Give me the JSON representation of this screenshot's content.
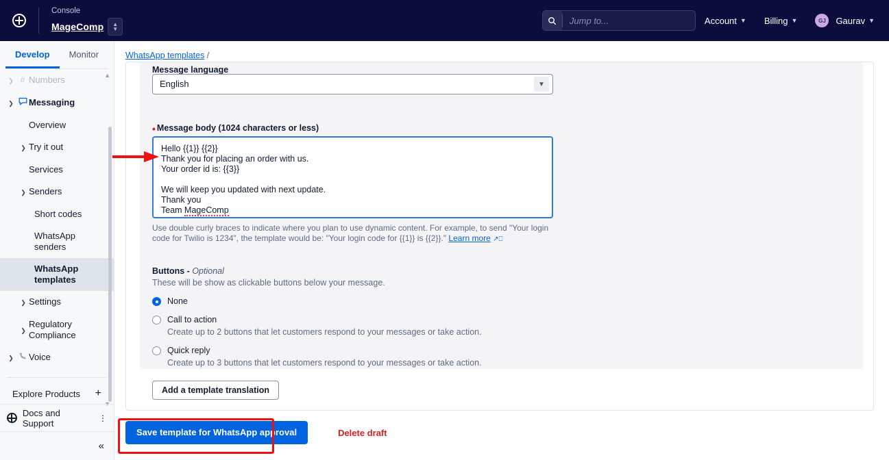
{
  "topnav": {
    "logo_icon": "twilio-logo-icon",
    "console_label": "Console",
    "account_name": "MageComp",
    "account_switcher_icon": "chevron-updown-icon",
    "search": {
      "icon": "search-icon",
      "placeholder": "Jump to...",
      "value": ""
    },
    "account_menu": "Account",
    "billing_menu": "Billing",
    "user_initials": "GJ",
    "user_name": "Gaurav",
    "caret_icon": "chevron-down-icon",
    "bg_color": "#0d0d3d"
  },
  "sidebar": {
    "tabs": [
      {
        "label": "Develop",
        "active": true
      },
      {
        "label": "Monitor",
        "active": false
      }
    ],
    "items": [
      {
        "label": "Numbers",
        "level": 1,
        "twist": "collapsed",
        "icon": "hash-icon",
        "faded": true,
        "active": false
      },
      {
        "label": "Messaging",
        "level": 1,
        "twist": "expanded",
        "icon": "chat-bubble-icon",
        "bold": true,
        "active": false
      },
      {
        "label": "Overview",
        "level": 2,
        "twist": "none",
        "active": false
      },
      {
        "label": "Try it out",
        "level": 2,
        "twist": "collapsed",
        "active": false
      },
      {
        "label": "Services",
        "level": 2,
        "twist": "none",
        "active": false
      },
      {
        "label": "Senders",
        "level": 2,
        "twist": "expanded",
        "active": false
      },
      {
        "label": "Short codes",
        "level": 3,
        "twist": "none",
        "active": false
      },
      {
        "label": "WhatsApp senders",
        "level": 3,
        "twist": "none",
        "active": false
      },
      {
        "label": "WhatsApp templates",
        "level": 3,
        "twist": "none",
        "active": true
      },
      {
        "label": "Settings",
        "level": 2,
        "twist": "collapsed",
        "active": false
      },
      {
        "label": "Regulatory Compliance",
        "level": 2,
        "twist": "collapsed",
        "active": false
      },
      {
        "label": "Voice",
        "level": 1,
        "twist": "collapsed",
        "icon": "phone-icon",
        "active": false
      }
    ],
    "explore_products": "Explore Products",
    "explore_plus_icon": "plus-icon",
    "docs_and_support": "Docs and Support",
    "kebab_icon": "more-vertical-icon",
    "collapse_icon": "chevron-double-left-icon",
    "accent_color": "#0263e0"
  },
  "main": {
    "breadcrumb": {
      "link": "WhatsApp templates",
      "separator": "/"
    },
    "message_language": {
      "label": "Message language",
      "value": "English",
      "chevron_icon": "chevron-down-icon"
    },
    "message_body": {
      "label": "Message body (1024 characters or less)",
      "required": true,
      "line1": "Hello {{1}} {{2}}",
      "line2": "Thank you for placing an order with us.",
      "line3": "Your order id is: {{3}}",
      "line4": "",
      "line5": "We will keep you updated with next update.",
      "line6": "Thank you",
      "line7_prefix": "Team ",
      "line7_misspelled": "MageComp",
      "help_text_part1": "Use double curly braces to indicate where you plan to use dynamic content. For example, to send \"Your login code for Twilio is 1234\", the template would be: \"Your login code for {{1}} is {{2}}.\" ",
      "help_link": "Learn more",
      "external_link_icon": "external-link-icon",
      "focus_border_color": "#2e7bd9"
    },
    "buttons_section": {
      "title": "Buttons - ",
      "title_optional": "Optional",
      "subtitle": "These will be show as clickable buttons below your message.",
      "options": [
        {
          "label": "None",
          "desc": "",
          "checked": true
        },
        {
          "label": "Call to action",
          "desc": "Create up to 2 buttons that let customers respond to your messages or take action.",
          "checked": false
        },
        {
          "label": "Quick reply",
          "desc": "Create up to 3 buttons that let customers respond to your messages or take action.",
          "checked": false
        }
      ]
    },
    "add_translation_button": "Add a template translation",
    "save_button": "Save template for WhatsApp approval",
    "delete_link": "Delete draft",
    "primary_color": "#0263e0",
    "danger_color": "#d61f1f"
  },
  "annotations": {
    "arrow_color": "#ee1111",
    "box_color": "#ee1111",
    "arrow_target": "message-body-textarea",
    "box_target": "save-template-button"
  }
}
